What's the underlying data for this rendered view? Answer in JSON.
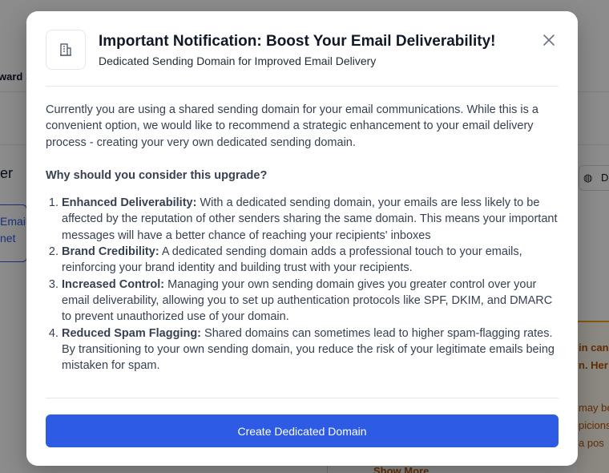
{
  "background": {
    "fragments": {
      "ward": "ward S",
      "er": "er",
      "email": "Email",
      "net": "net",
      "d_label": "D",
      "in_can": "in can",
      "n_her": "n. Her",
      "may_be": "may be",
      "picions": "picions",
      "a_pos": "a pos",
      "show_more": "Show More"
    }
  },
  "modal": {
    "header_icon": "building-icon",
    "title": "Important Notification: Boost Your Email Deliverability!",
    "subtitle": "Dedicated Sending Domain for Improved Email Delivery",
    "close_icon": "close-icon",
    "intro": "Currently you are using a shared sending domain for your email communications. While this is a convenient option, we would like to recommend a strategic enhancement to your email delivery process - creating your very own dedicated sending domain.",
    "why_heading": "Why should you consider this upgrade?",
    "reasons": [
      {
        "lead": "Enhanced Deliverability:",
        "text": " With a dedicated sending domain, your emails are less likely to be affected by the reputation of other senders sharing the same domain. This means your important messages will have a better chance of reaching your recipients' inboxes"
      },
      {
        "lead": "Brand Credibility:",
        "text": " A dedicated sending domain adds a professional touch to your emails, reinforcing your brand identity and building trust with your recipients."
      },
      {
        "lead": "Increased Control:",
        "text": " Managing your own sending domain gives you greater control over your email deliverability, allowing you to set up authentication protocols like SPF, DKIM, and DMARC to prevent unauthorized use of your domain."
      },
      {
        "lead": "Reduced Spam Flagging:",
        "text": " Shared domains can sometimes lead to higher spam-flagging rates. By transitioning to your own sending domain, you reduce the risk of your legitimate emails being mistaken for spam."
      }
    ],
    "cta_label": "Create Dedicated Domain"
  },
  "colors": {
    "primary": "#2d5be3",
    "overlay": "rgba(0,0,0,0.45)"
  }
}
